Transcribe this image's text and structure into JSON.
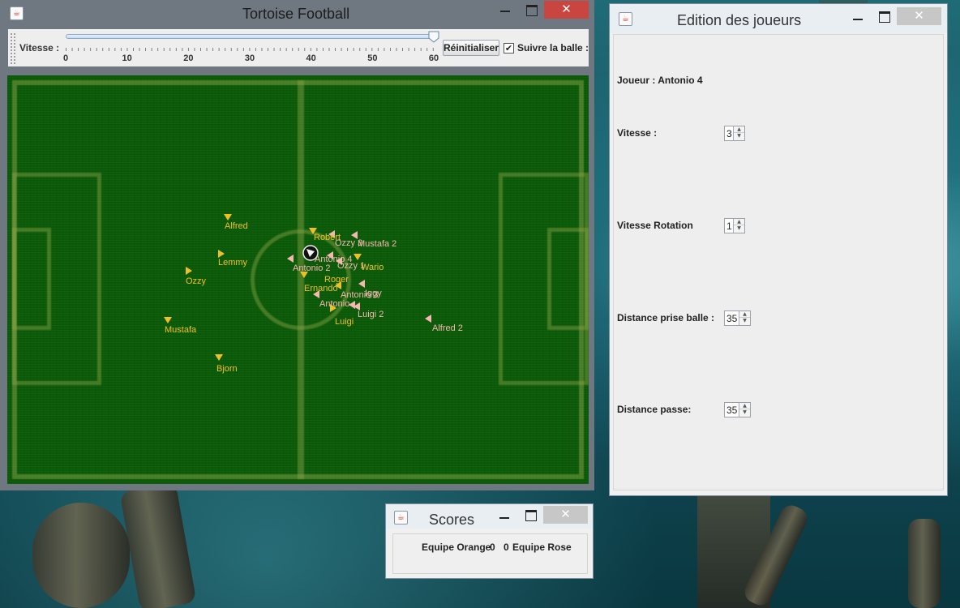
{
  "main_window": {
    "title": "Tortoise Football",
    "toolbar": {
      "speed_label": "Vitesse :",
      "speed_value": 60,
      "speed_min": 0,
      "speed_max": 60,
      "ticks": [
        "0",
        "10",
        "20",
        "30",
        "40",
        "50",
        "60"
      ],
      "reset_label": "Réinitialiser",
      "follow_ball_checked": true,
      "follow_ball_label": "Suivre la balle :"
    },
    "players": [
      {
        "name": "Alfred",
        "team": "orange"
      },
      {
        "name": "Robert",
        "team": "orange"
      },
      {
        "name": "Ozzy 3",
        "team": "pink"
      },
      {
        "name": "Mustafa 2",
        "team": "pink"
      },
      {
        "name": "Antonio 4",
        "team": "pink"
      },
      {
        "name": "Lemmy",
        "team": "orange"
      },
      {
        "name": "Antonio 2",
        "team": "pink"
      },
      {
        "name": "Ozzy 1",
        "team": "pink"
      },
      {
        "name": "Wario",
        "team": "orange"
      },
      {
        "name": "Ozzy",
        "team": "orange"
      },
      {
        "name": "Roger",
        "team": "orange"
      },
      {
        "name": "Ernando",
        "team": "orange"
      },
      {
        "name": "Iggy",
        "team": "pink"
      },
      {
        "name": "Antonio 3",
        "team": "pink"
      },
      {
        "name": "Antonio",
        "team": "pink"
      },
      {
        "name": "Luigi 2",
        "team": "pink"
      },
      {
        "name": "Luigi",
        "team": "orange"
      },
      {
        "name": "Alfred 2",
        "team": "pink"
      },
      {
        "name": "Mustafa",
        "team": "orange"
      },
      {
        "name": "Bjorn",
        "team": "orange"
      }
    ],
    "colors": {
      "orange_team": "#f0c020",
      "pink_team": "#f4b8b0",
      "pitch": "#0b5a08"
    }
  },
  "edition_window": {
    "title": "Edition des joueurs",
    "player_label": "Joueur : Antonio 4",
    "fields": [
      {
        "label": "Vitesse :",
        "value": "3"
      },
      {
        "label": "Vitesse Rotation",
        "value": "1"
      },
      {
        "label": "Distance prise balle :",
        "value": "35"
      },
      {
        "label": "Distance passe:",
        "value": "35"
      }
    ]
  },
  "scores_window": {
    "title": "Scores",
    "team_left": "Equipe Orange",
    "score_left": "0",
    "score_right": "0",
    "team_right": "Equipe Rose"
  },
  "icons": {
    "window_icon": "java-cup-icon",
    "minimize": "minimize-icon",
    "maximize": "maximize-icon",
    "close": "close-icon",
    "ball": "ball-icon"
  }
}
